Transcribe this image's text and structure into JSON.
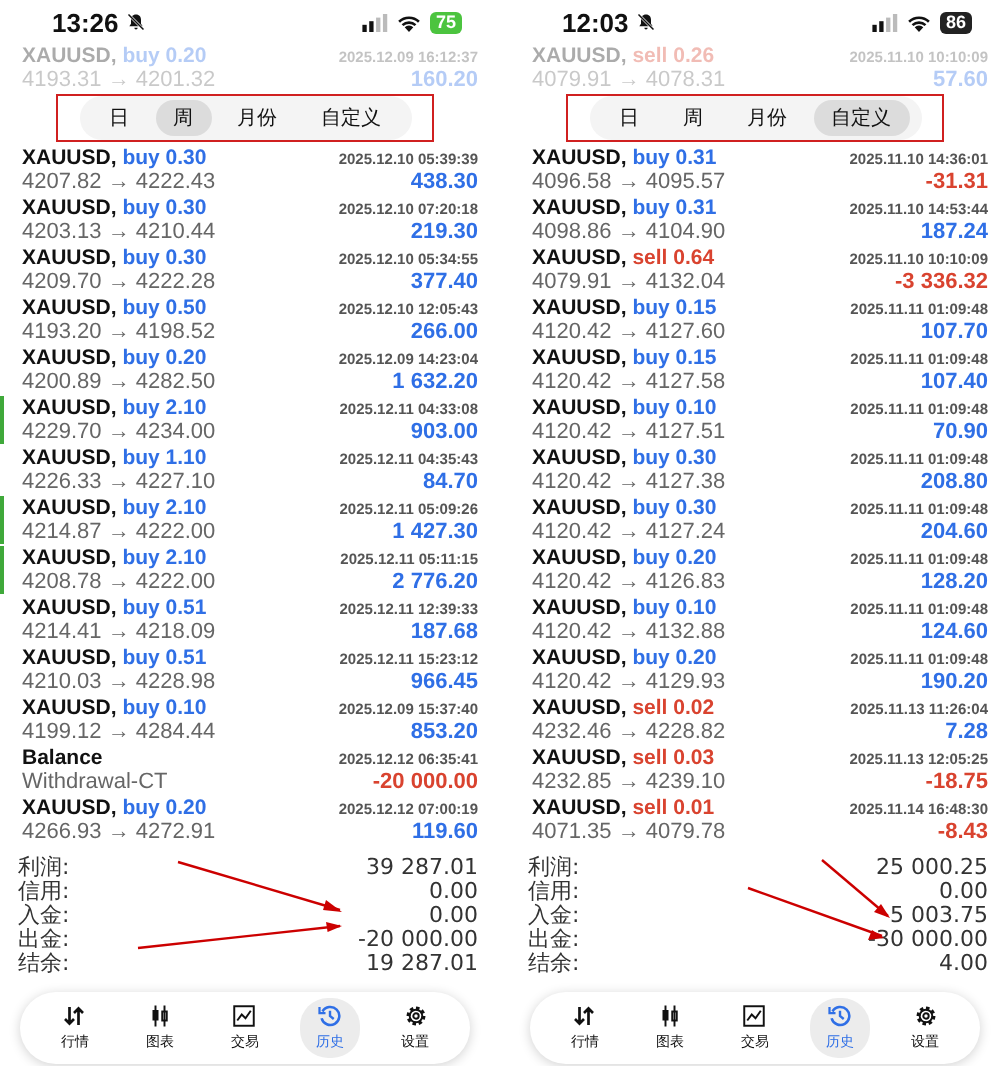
{
  "panels": [
    {
      "status_bar": {
        "time": "13:26",
        "battery": "75",
        "charging": true
      },
      "top_row": {
        "symbol": "XAUUSD,",
        "order": "buy 0.20",
        "sell": false,
        "prices": "4193.31 → 4201.32",
        "time": "2025.12.09 16:12:37",
        "profit": "160.20",
        "negative": false
      },
      "tabs": [
        {
          "label": "日",
          "selected": false
        },
        {
          "label": "周",
          "selected": true
        },
        {
          "label": "月份",
          "selected": false
        },
        {
          "label": "自定义",
          "selected": false
        }
      ],
      "rows": [
        {
          "kind": "trade",
          "symbol": "XAUUSD,",
          "order": "buy 0.30",
          "sell": false,
          "prices": "4207.82 → 4222.43",
          "time": "2025.12.10 05:39:39",
          "profit": "438.30",
          "negative": false,
          "marked": false
        },
        {
          "kind": "trade",
          "symbol": "XAUUSD,",
          "order": "buy 0.30",
          "sell": false,
          "prices": "4203.13 → 4210.44",
          "time": "2025.12.10 07:20:18",
          "profit": "219.30",
          "negative": false,
          "marked": false
        },
        {
          "kind": "trade",
          "symbol": "XAUUSD,",
          "order": "buy 0.30",
          "sell": false,
          "prices": "4209.70 → 4222.28",
          "time": "2025.12.10 05:34:55",
          "profit": "377.40",
          "negative": false,
          "marked": false
        },
        {
          "kind": "trade",
          "symbol": "XAUUSD,",
          "order": "buy 0.50",
          "sell": false,
          "prices": "4193.20 → 4198.52",
          "time": "2025.12.10 12:05:43",
          "profit": "266.00",
          "negative": false,
          "marked": false
        },
        {
          "kind": "trade",
          "symbol": "XAUUSD,",
          "order": "buy 0.20",
          "sell": false,
          "prices": "4200.89 → 4282.50",
          "time": "2025.12.09 14:23:04",
          "profit": "1 632.20",
          "negative": false,
          "marked": false
        },
        {
          "kind": "trade",
          "symbol": "XAUUSD,",
          "order": "buy 2.10",
          "sell": false,
          "prices": "4229.70 → 4234.00",
          "time": "2025.12.11 04:33:08",
          "profit": "903.00",
          "negative": false,
          "marked": true
        },
        {
          "kind": "trade",
          "symbol": "XAUUSD,",
          "order": "buy 1.10",
          "sell": false,
          "prices": "4226.33 → 4227.10",
          "time": "2025.12.11 04:35:43",
          "profit": "84.70",
          "negative": false,
          "marked": false
        },
        {
          "kind": "trade",
          "symbol": "XAUUSD,",
          "order": "buy 2.10",
          "sell": false,
          "prices": "4214.87 → 4222.00",
          "time": "2025.12.11 05:09:26",
          "profit": "1 427.30",
          "negative": false,
          "marked": true
        },
        {
          "kind": "trade",
          "symbol": "XAUUSD,",
          "order": "buy 2.10",
          "sell": false,
          "prices": "4208.78 → 4222.00",
          "time": "2025.12.11 05:11:15",
          "profit": "2 776.20",
          "negative": false,
          "marked": true
        },
        {
          "kind": "trade",
          "symbol": "XAUUSD,",
          "order": "buy 0.51",
          "sell": false,
          "prices": "4214.41 → 4218.09",
          "time": "2025.12.11 12:39:33",
          "profit": "187.68",
          "negative": false,
          "marked": false
        },
        {
          "kind": "trade",
          "symbol": "XAUUSD,",
          "order": "buy 0.51",
          "sell": false,
          "prices": "4210.03 → 4228.98",
          "time": "2025.12.11 15:23:12",
          "profit": "966.45",
          "negative": false,
          "marked": false
        },
        {
          "kind": "trade",
          "symbol": "XAUUSD,",
          "order": "buy 0.10",
          "sell": false,
          "prices": "4199.12 → 4284.44",
          "time": "2025.12.09 15:37:40",
          "profit": "853.20",
          "negative": false,
          "marked": false
        },
        {
          "kind": "balance",
          "symbol": "Balance",
          "comment": "Withdrawal-CT",
          "time": "2025.12.12 06:35:41",
          "profit": "-20 000.00",
          "negative": true,
          "marked": false
        },
        {
          "kind": "trade",
          "symbol": "XAUUSD,",
          "order": "buy 0.20",
          "sell": false,
          "prices": "4266.93 → 4272.91",
          "time": "2025.12.12 07:00:19",
          "profit": "119.60",
          "negative": false,
          "marked": false
        }
      ],
      "summary": [
        {
          "label": "利润:",
          "value": "39 287.01"
        },
        {
          "label": "信用:",
          "value": "0.00"
        },
        {
          "label": "入金:",
          "value": "0.00"
        },
        {
          "label": "出金:",
          "value": "-20 000.00"
        },
        {
          "label": "结余:",
          "value": "19 287.01"
        }
      ],
      "nav": [
        {
          "label": "行情",
          "selected": false
        },
        {
          "label": "图表",
          "selected": false
        },
        {
          "label": "交易",
          "selected": false
        },
        {
          "label": "历史",
          "selected": true
        },
        {
          "label": "设置",
          "selected": false
        }
      ]
    },
    {
      "status_bar": {
        "time": "12:03",
        "battery": "86",
        "charging": false
      },
      "top_row": {
        "symbol": "XAUUSD,",
        "order": "sell 0.26",
        "sell": true,
        "prices": "4079.91 → 4078.31",
        "time": "2025.11.10 10:10:09",
        "profit": "57.60",
        "negative": false
      },
      "tabs": [
        {
          "label": "日",
          "selected": false
        },
        {
          "label": "周",
          "selected": false
        },
        {
          "label": "月份",
          "selected": false
        },
        {
          "label": "自定义",
          "selected": true
        }
      ],
      "rows": [
        {
          "kind": "trade",
          "symbol": "XAUUSD,",
          "order": "buy 0.31",
          "sell": false,
          "prices": "4096.58 → 4095.57",
          "time": "2025.11.10 14:36:01",
          "profit": "-31.31",
          "negative": true,
          "marked": false
        },
        {
          "kind": "trade",
          "symbol": "XAUUSD,",
          "order": "buy 0.31",
          "sell": false,
          "prices": "4098.86 → 4104.90",
          "time": "2025.11.10 14:53:44",
          "profit": "187.24",
          "negative": false,
          "marked": false
        },
        {
          "kind": "trade",
          "symbol": "XAUUSD,",
          "order": "sell 0.64",
          "sell": true,
          "prices": "4079.91 → 4132.04",
          "time": "2025.11.10 10:10:09",
          "profit": "-3 336.32",
          "negative": true,
          "marked": false
        },
        {
          "kind": "trade",
          "symbol": "XAUUSD,",
          "order": "buy 0.15",
          "sell": false,
          "prices": "4120.42 → 4127.60",
          "time": "2025.11.11 01:09:48",
          "profit": "107.70",
          "negative": false,
          "marked": false
        },
        {
          "kind": "trade",
          "symbol": "XAUUSD,",
          "order": "buy 0.15",
          "sell": false,
          "prices": "4120.42 → 4127.58",
          "time": "2025.11.11 01:09:48",
          "profit": "107.40",
          "negative": false,
          "marked": false
        },
        {
          "kind": "trade",
          "symbol": "XAUUSD,",
          "order": "buy 0.10",
          "sell": false,
          "prices": "4120.42 → 4127.51",
          "time": "2025.11.11 01:09:48",
          "profit": "70.90",
          "negative": false,
          "marked": false
        },
        {
          "kind": "trade",
          "symbol": "XAUUSD,",
          "order": "buy 0.30",
          "sell": false,
          "prices": "4120.42 → 4127.38",
          "time": "2025.11.11 01:09:48",
          "profit": "208.80",
          "negative": false,
          "marked": false
        },
        {
          "kind": "trade",
          "symbol": "XAUUSD,",
          "order": "buy 0.30",
          "sell": false,
          "prices": "4120.42 → 4127.24",
          "time": "2025.11.11 01:09:48",
          "profit": "204.60",
          "negative": false,
          "marked": false
        },
        {
          "kind": "trade",
          "symbol": "XAUUSD,",
          "order": "buy 0.20",
          "sell": false,
          "prices": "4120.42 → 4126.83",
          "time": "2025.11.11 01:09:48",
          "profit": "128.20",
          "negative": false,
          "marked": false
        },
        {
          "kind": "trade",
          "symbol": "XAUUSD,",
          "order": "buy 0.10",
          "sell": false,
          "prices": "4120.42 → 4132.88",
          "time": "2025.11.11 01:09:48",
          "profit": "124.60",
          "negative": false,
          "marked": false
        },
        {
          "kind": "trade",
          "symbol": "XAUUSD,",
          "order": "buy 0.20",
          "sell": false,
          "prices": "4120.42 → 4129.93",
          "time": "2025.11.11 01:09:48",
          "profit": "190.20",
          "negative": false,
          "marked": false
        },
        {
          "kind": "trade",
          "symbol": "XAUUSD,",
          "order": "sell 0.02",
          "sell": true,
          "prices": "4232.46 → 4228.82",
          "time": "2025.11.13 11:26:04",
          "profit": "7.28",
          "negative": false,
          "marked": false
        },
        {
          "kind": "trade",
          "symbol": "XAUUSD,",
          "order": "sell 0.03",
          "sell": true,
          "prices": "4232.85 → 4239.10",
          "time": "2025.11.13 12:05:25",
          "profit": "-18.75",
          "negative": true,
          "marked": false
        },
        {
          "kind": "trade",
          "symbol": "XAUUSD,",
          "order": "sell 0.01",
          "sell": true,
          "prices": "4071.35 → 4079.78",
          "time": "2025.11.14 16:48:30",
          "profit": "-8.43",
          "negative": true,
          "marked": false
        }
      ],
      "summary": [
        {
          "label": "利润:",
          "value": "25 000.25"
        },
        {
          "label": "信用:",
          "value": "0.00"
        },
        {
          "label": "入金:",
          "value": "5 003.75"
        },
        {
          "label": "出金:",
          "value": "-30 000.00"
        },
        {
          "label": "结余:",
          "value": "4.00"
        }
      ],
      "nav": [
        {
          "label": "行情",
          "selected": false
        },
        {
          "label": "图表",
          "selected": false
        },
        {
          "label": "交易",
          "selected": false
        },
        {
          "label": "历史",
          "selected": true
        },
        {
          "label": "设置",
          "selected": false
        }
      ]
    }
  ]
}
